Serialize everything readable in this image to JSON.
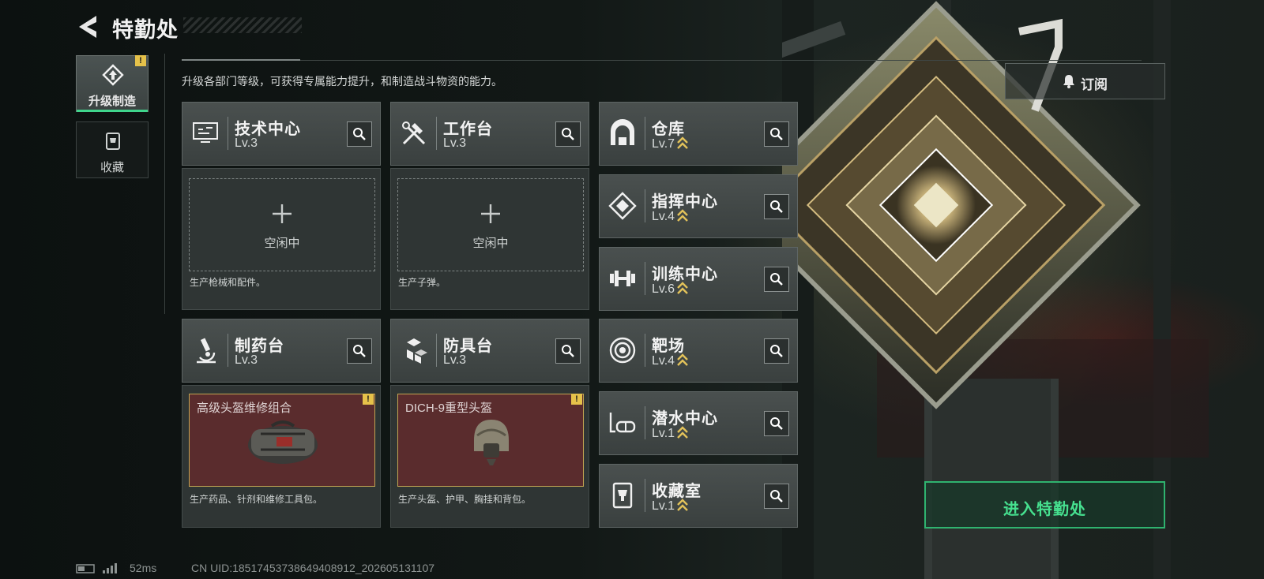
{
  "header": {
    "title": "特勤处"
  },
  "tabs": [
    {
      "label": "升级制造",
      "badge": "!"
    },
    {
      "label": "收藏"
    }
  ],
  "intro": "升级各部门等级，可获得专属能力提升，和制造战斗物资的能力。",
  "subscribe": {
    "label": "订阅"
  },
  "stations": {
    "tech_center": {
      "name": "技术中心",
      "level": "Lv.3",
      "icon": "tech-monitor-icon"
    },
    "workbench": {
      "name": "工作台",
      "level": "Lv.3",
      "icon": "hammer-wrench-icon"
    },
    "warehouse": {
      "name": "仓库",
      "level": "Lv.7",
      "icon": "warehouse-icon"
    },
    "command_center": {
      "name": "指挥中心",
      "level": "Lv.4",
      "icon": "command-diamond-icon"
    },
    "training_center": {
      "name": "训练中心",
      "level": "Lv.6",
      "icon": "dumbbell-icon"
    },
    "pharmacy": {
      "name": "制药台",
      "level": "Lv.3",
      "icon": "microscope-icon"
    },
    "armor_bench": {
      "name": "防具台",
      "level": "Lv.3",
      "icon": "cubes-icon"
    },
    "shooting_range": {
      "name": "靶场",
      "level": "Lv.4",
      "icon": "target-icon"
    },
    "diving_center": {
      "name": "潜水中心",
      "level": "Lv.1",
      "icon": "diving-mask-icon"
    },
    "collection_room": {
      "name": "收藏室",
      "level": "Lv.1",
      "icon": "trophy-icon"
    }
  },
  "production": {
    "tech_center": {
      "status": "空闲中",
      "desc": "生产枪械和配件。"
    },
    "workbench": {
      "status": "空闲中",
      "desc": "生产子弹。"
    },
    "pharmacy": {
      "item": "高级头盔维修组合",
      "badge": "!",
      "desc": "生产药品、针剂和维修工具包。"
    },
    "armor_bench": {
      "item": "DICH-9重型头盔",
      "badge": "!",
      "desc": "生产头盔、护甲、胸挂和背包。"
    }
  },
  "enter_button": {
    "label": "进入特勤处"
  },
  "footer": {
    "ping": "52ms",
    "uid": "CN UID:1851745373864940891​2_202605131107"
  },
  "colors": {
    "accent_green": "#2fb36f",
    "badge_yellow": "#e6c24a",
    "upgrade_chevron": "#e2c25a",
    "craft_bg": "#5a2c2d"
  }
}
